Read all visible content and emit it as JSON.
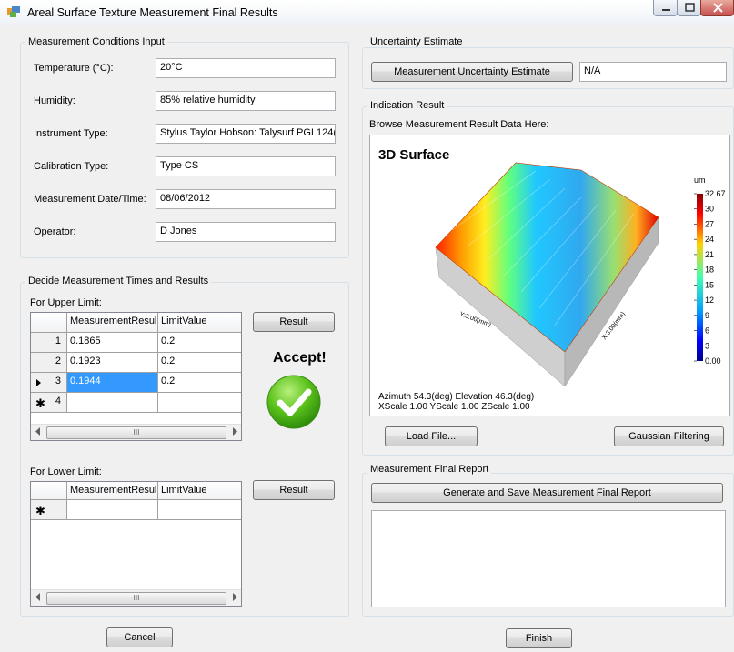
{
  "window": {
    "title": "Areal Surface Texture Measurement Final Results"
  },
  "conditions": {
    "group_label": "Measurement Conditions Input",
    "fields": [
      {
        "label": "Temperature (°C):",
        "value": "20°C"
      },
      {
        "label": "Humidity:",
        "value": "85% relative humidity"
      },
      {
        "label": "Instrument Type:",
        "value": "Stylus Taylor Hobson: Talysurf PGI 124("
      },
      {
        "label": "Calibration Type:",
        "value": "Type CS"
      },
      {
        "label": "Measurement Date/Time:",
        "value": "08/06/2012"
      },
      {
        "label": "Operator:",
        "value": "D Jones"
      }
    ]
  },
  "decide": {
    "group_label": "Decide Measurement Times and Results",
    "upper": {
      "label": "For Upper Limit:",
      "columns": [
        "MeasurementResul",
        "LimitValue"
      ],
      "rows": [
        {
          "num": "1",
          "result": "0.1865",
          "limit": "0.2"
        },
        {
          "num": "2",
          "result": "0.1923",
          "limit": "0.2"
        },
        {
          "num": "3",
          "result": "0.1944",
          "limit": "0.2"
        }
      ],
      "new_row_num": "4",
      "button": "Result",
      "verdict": "Accept!"
    },
    "lower": {
      "label": "For Lower Limit:",
      "columns": [
        "MeasurementResul",
        "LimitValue"
      ],
      "button": "Result"
    },
    "scroll_thumb_glyph": "III"
  },
  "uncertainty": {
    "group_label": "Uncertainty Estimate",
    "button": "Measurement Uncertainty Estimate",
    "value": "N/A"
  },
  "indication": {
    "group_label": "Indication Result",
    "browse_label": "Browse Measurement Result Data Here:",
    "plot_title": "3D Surface",
    "unit": "um",
    "colorbar_ticks": [
      "32.67",
      "30",
      "27",
      "24",
      "21",
      "18",
      "15",
      "12",
      "9",
      "6",
      "3",
      "0.00"
    ],
    "y_axis_label": "Y:3.00(mm)",
    "x_axis_label": "X:3.00(mm)",
    "info_line1": "Azimuth  54.3(deg)  Elevation  46.3(deg)",
    "info_line2": "XScale  1.00  YScale  1.00  ZScale  1.00",
    "load_button": "Load File...",
    "gaussian_button": "Gaussian Filtering",
    "colors": {
      "high": "#d00000",
      "mid": "#00c8ff",
      "low": "#0000b0"
    }
  },
  "report": {
    "group_label": "Measurement Final Report",
    "button": "Generate and Save Measurement Final Report"
  },
  "footer": {
    "cancel": "Cancel",
    "finish": "Finish"
  }
}
